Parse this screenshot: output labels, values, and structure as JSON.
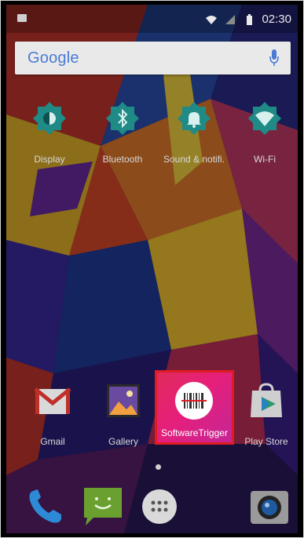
{
  "status": {
    "time": "02:30",
    "icons": [
      "notification-icon",
      "wifi-icon",
      "signal-icon",
      "battery-icon"
    ]
  },
  "search": {
    "brand": "Google",
    "mic_icon": "mic-icon"
  },
  "widgets": [
    {
      "label": "Display",
      "icon": "display-icon"
    },
    {
      "label": "Bluetooth",
      "icon": "bluetooth-icon"
    },
    {
      "label": "Sound & notifi.",
      "icon": "bell-icon"
    },
    {
      "label": "Wi-Fi",
      "icon": "wifi-icon"
    }
  ],
  "apps": [
    {
      "label": "Gmail",
      "icon": "gmail-icon"
    },
    {
      "label": "Gallery",
      "icon": "gallery-icon"
    },
    {
      "label": "SoftwareTrigger",
      "icon": "barcode-icon"
    },
    {
      "label": "Play Store",
      "icon": "play-store-icon"
    }
  ],
  "dock": [
    {
      "icon": "phone-icon"
    },
    {
      "icon": "messaging-icon"
    },
    {
      "icon": "app-drawer-icon"
    },
    {
      "icon": "camera-icon"
    }
  ],
  "colors": {
    "highlight": "#e01b22",
    "google_blue": "#4a7ad6",
    "widget_teal": "#1f8a86"
  }
}
